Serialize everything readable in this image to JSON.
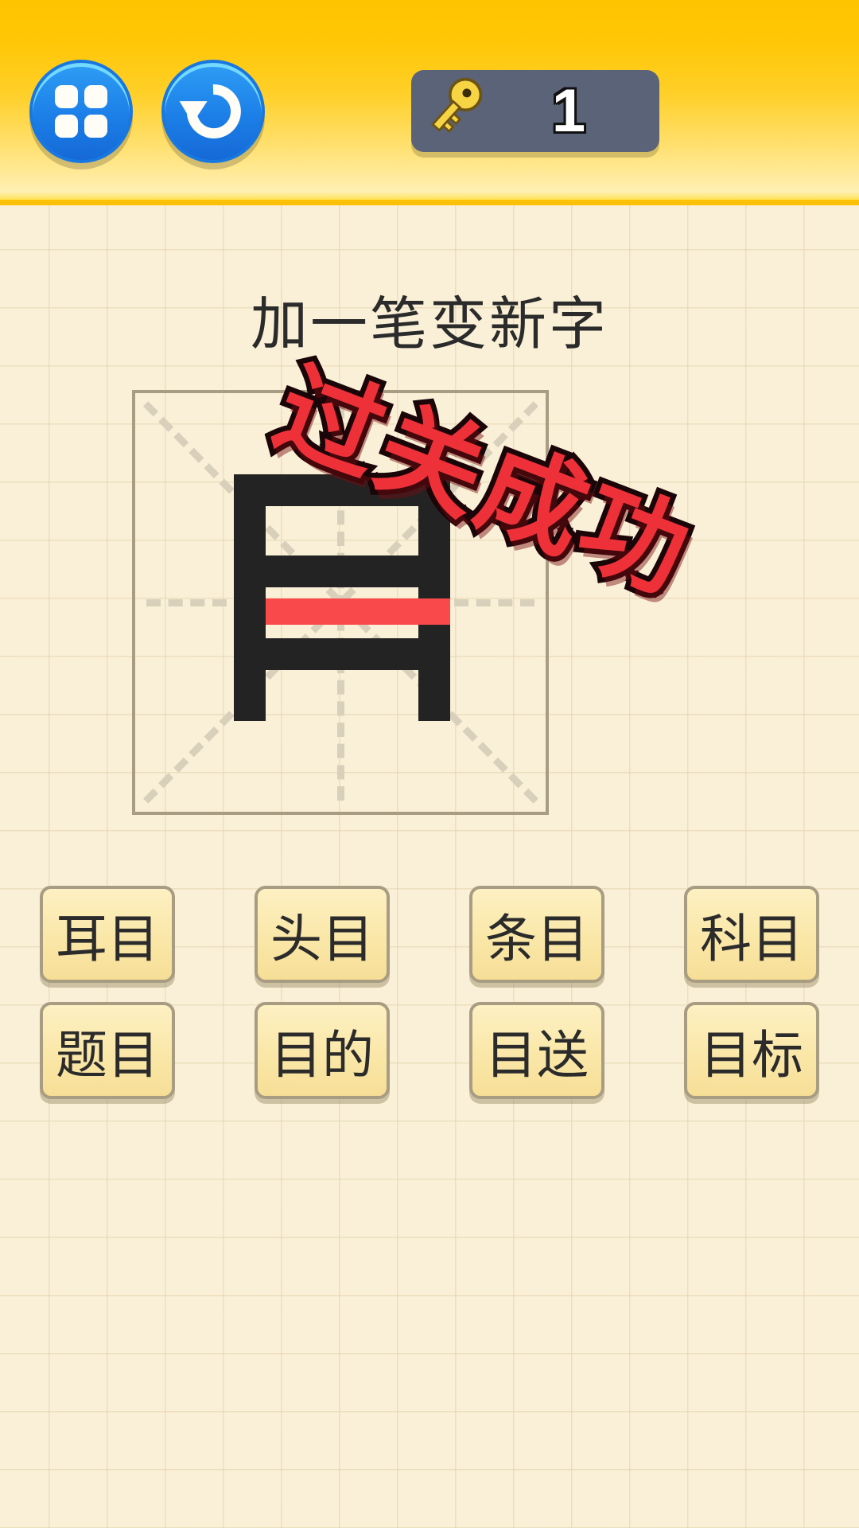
{
  "topbar": {
    "menu_button": {
      "icon": "grid-four-squares-icon",
      "label": ""
    },
    "restart_button": {
      "icon": "undo-arrow-icon",
      "label": ""
    },
    "key_badge": {
      "icon": "key-icon",
      "count": "1"
    }
  },
  "stage": {
    "title": "加一笔变新字",
    "success_text": "过关成功",
    "character": {
      "base": "日",
      "result": "目",
      "added_stroke_color": "#F9494B",
      "stroke_color": "#232323"
    }
  },
  "answers": {
    "rows": [
      [
        {
          "label": "耳目"
        },
        {
          "label": "头目"
        },
        {
          "label": "条目"
        },
        {
          "label": "科目"
        }
      ],
      [
        {
          "label": "题目"
        },
        {
          "label": "目的"
        },
        {
          "label": "目送"
        },
        {
          "label": "目标"
        }
      ]
    ]
  },
  "colors": {
    "topbar_yellow": "#FFC400",
    "paper": "#FAF0D7",
    "grid_line": "#E1D1AC",
    "button_blue": "#1C7FE8",
    "badge_gray": "#5B6378",
    "stamp_red": "#EE3138",
    "ink_black": "#232323",
    "answer_border": "#A89C82"
  }
}
